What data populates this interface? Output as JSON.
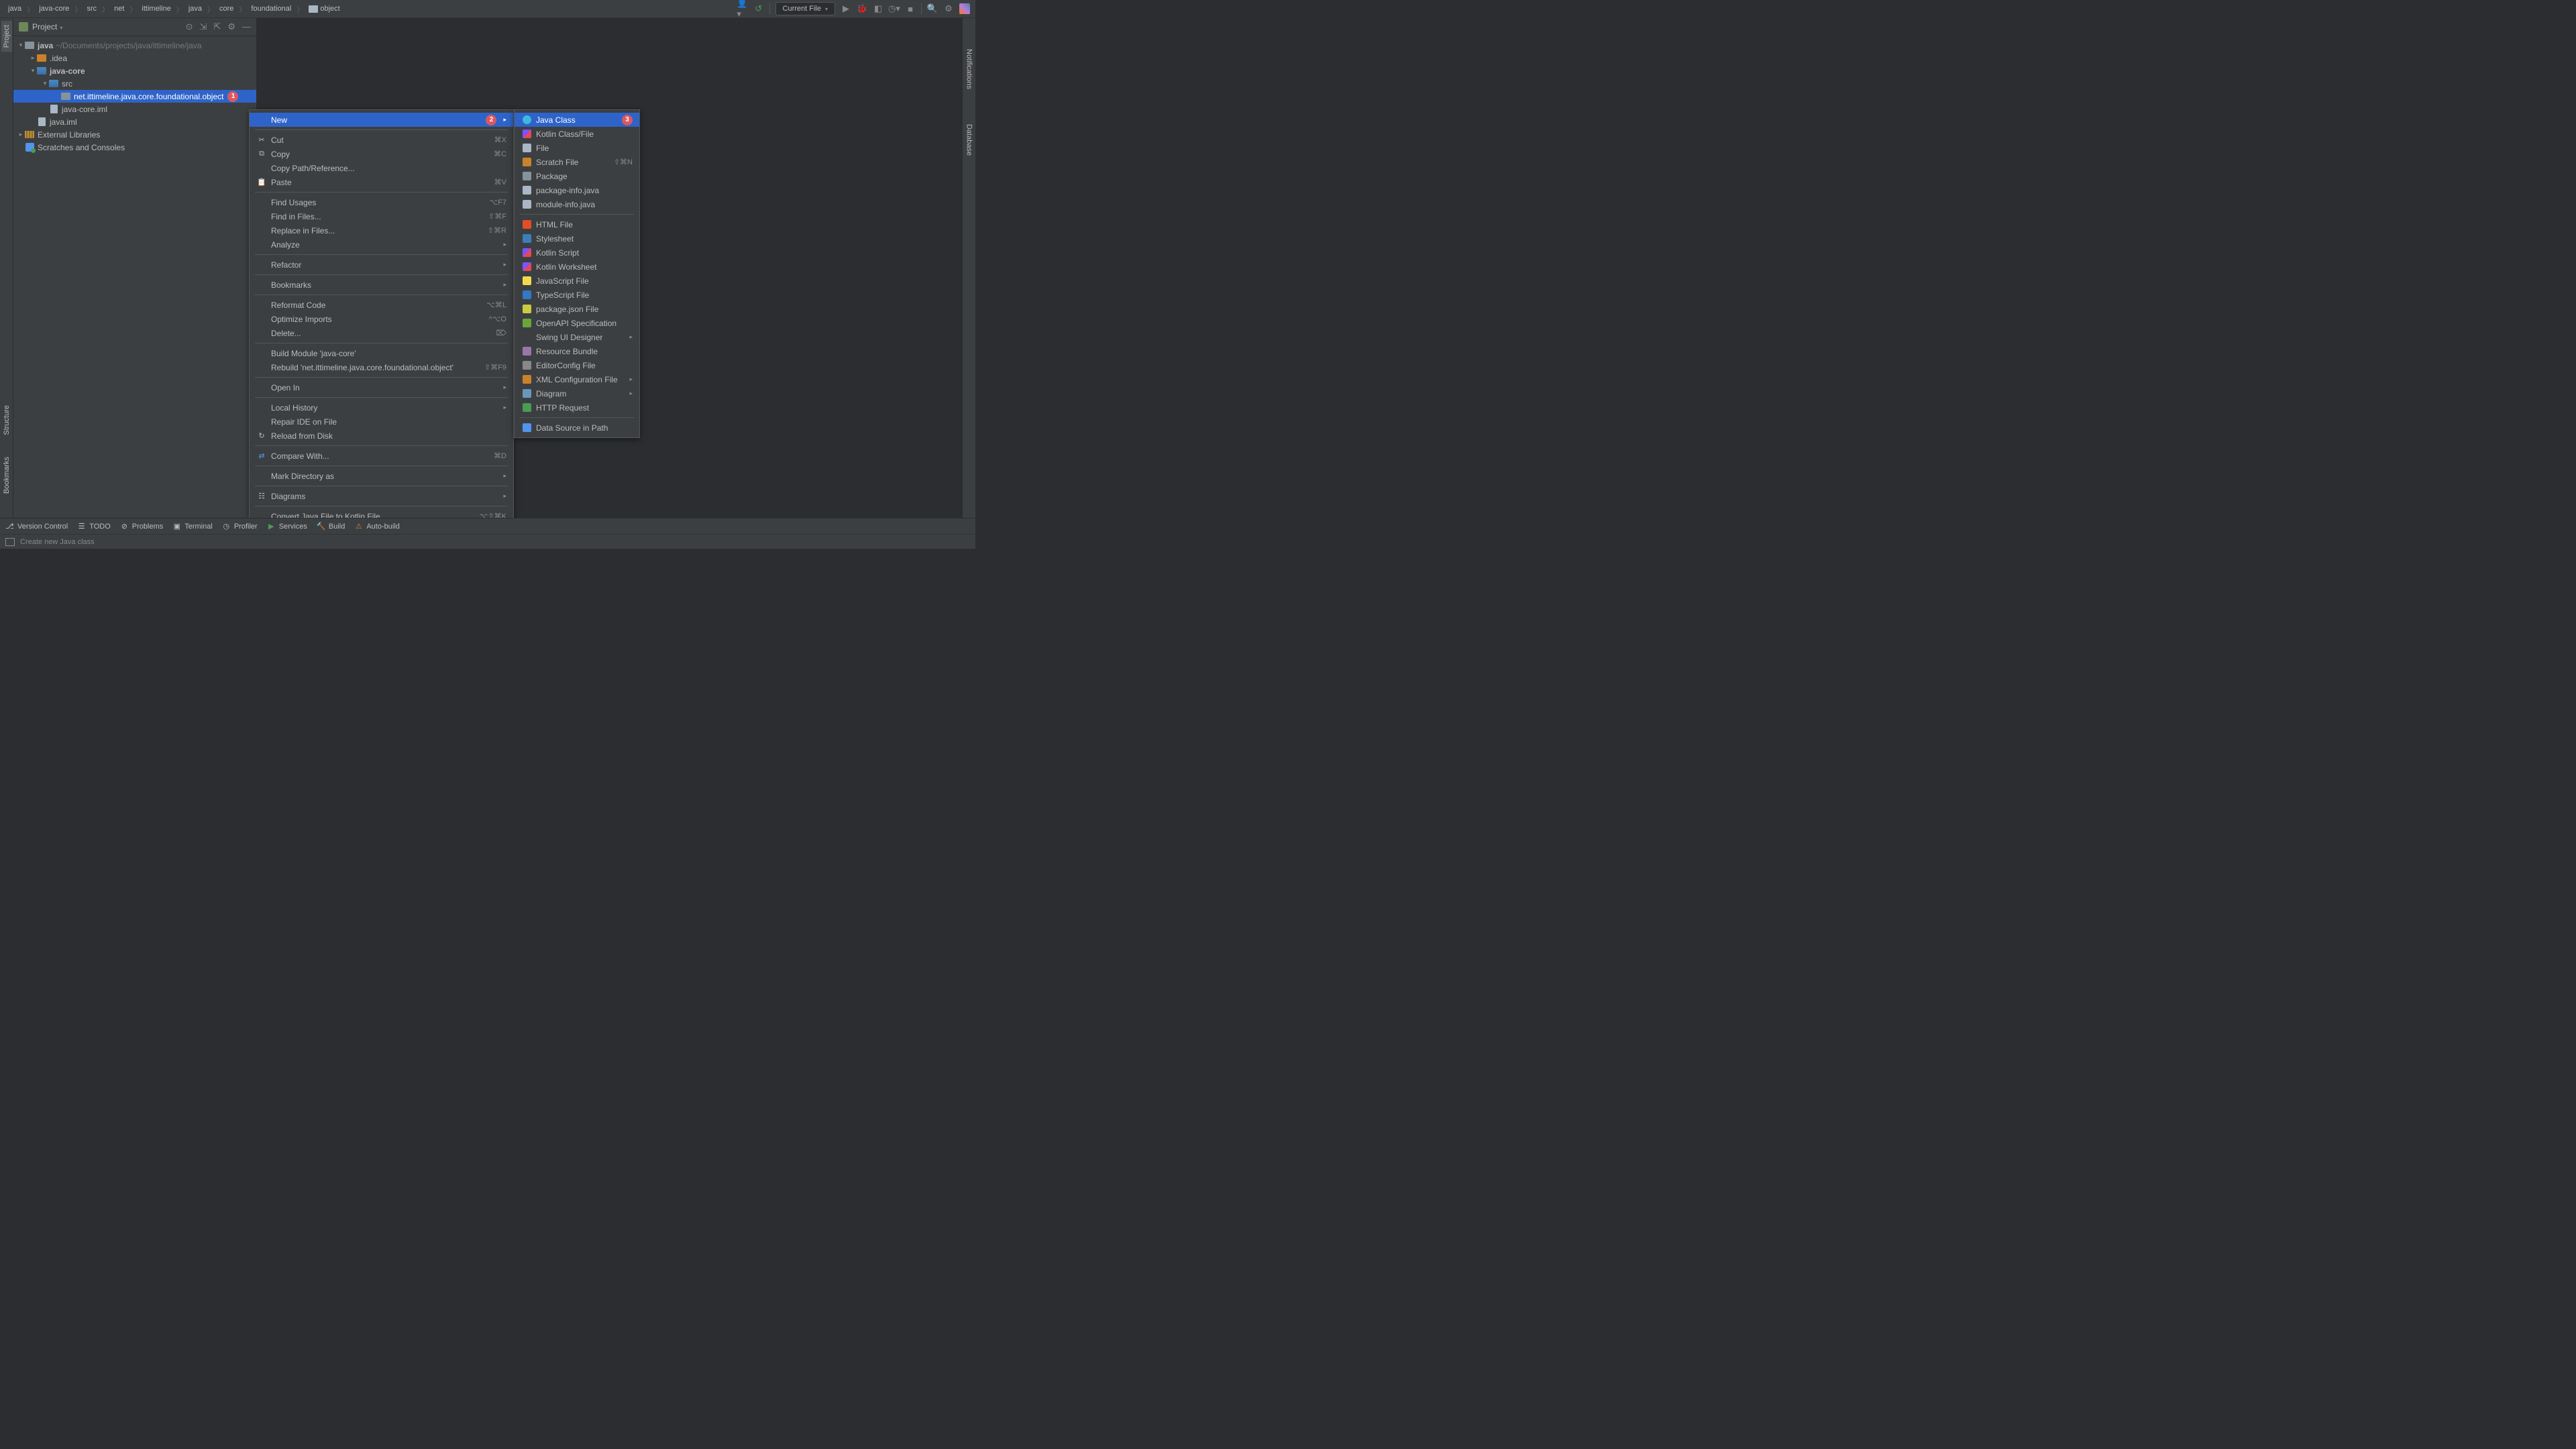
{
  "breadcrumbs": [
    "java",
    "java-core",
    "src",
    "net",
    "ittimeline",
    "java",
    "core",
    "foundational",
    "object"
  ],
  "topbar": {
    "run_config": "Current File"
  },
  "project": {
    "header": "Project",
    "tree": {
      "root_name": "java",
      "root_path": "~/Documents/projects/java/ittimeline/java",
      "idea": ".idea",
      "javacore": "java-core",
      "src": "src",
      "package": "net.ittimeline.java.core.foundational.object",
      "javacore_iml": "java-core.iml",
      "java_iml": "java.iml",
      "ext_libs": "External Libraries",
      "scratches": "Scratches and Consoles"
    }
  },
  "callouts": {
    "one": "1",
    "two": "2",
    "three": "3"
  },
  "context_menu": {
    "new": "New",
    "cut": {
      "label": "Cut",
      "sc": "⌘X"
    },
    "copy": {
      "label": "Copy",
      "sc": "⌘C"
    },
    "copy_path": "Copy Path/Reference...",
    "paste": {
      "label": "Paste",
      "sc": "⌘V"
    },
    "find_usages": {
      "label": "Find Usages",
      "sc": "⌥F7"
    },
    "find_in_files": {
      "label": "Find in Files...",
      "sc": "⇧⌘F"
    },
    "replace_in_files": {
      "label": "Replace in Files...",
      "sc": "⇧⌘R"
    },
    "analyze": "Analyze",
    "refactor": "Refactor",
    "bookmarks": "Bookmarks",
    "reformat": {
      "label": "Reformat Code",
      "sc": "⌥⌘L"
    },
    "optimize": {
      "label": "Optimize Imports",
      "sc": "^⌥O"
    },
    "delete": {
      "label": "Delete...",
      "sc": "⌦"
    },
    "build_module": "Build Module 'java-core'",
    "rebuild": {
      "label": "Rebuild 'net.ittimeline.java.core.foundational.object'",
      "sc": "⇧⌘F9"
    },
    "open_in": "Open In",
    "local_history": "Local History",
    "repair_ide": "Repair IDE on File",
    "reload": "Reload from Disk",
    "compare": {
      "label": "Compare With...",
      "sc": "⌘D"
    },
    "mark_dir": "Mark Directory as",
    "diagrams": "Diagrams",
    "convert_kotlin": {
      "label": "Convert Java File to Kotlin File",
      "sc": "⌥⇧⌘K"
    }
  },
  "new_submenu": {
    "java_class": "Java Class",
    "kotlin_class": "Kotlin Class/File",
    "file": "File",
    "scratch": {
      "label": "Scratch File",
      "sc": "⇧⌘N"
    },
    "package": "Package",
    "package_info": "package-info.java",
    "module_info": "module-info.java",
    "html": "HTML File",
    "stylesheet": "Stylesheet",
    "kotlin_script": "Kotlin Script",
    "kotlin_ws": "Kotlin Worksheet",
    "js": "JavaScript File",
    "ts": "TypeScript File",
    "packagejson": "package.json File",
    "openapi": "OpenAPI Specification",
    "swing": "Swing UI Designer",
    "resource": "Resource Bundle",
    "editorconfig": "EditorConfig File",
    "xml_config": "XML Configuration File",
    "diagram": "Diagram",
    "http": "HTTP Request",
    "datasource": "Data Source in Path"
  },
  "bottom": {
    "version_control": "Version Control",
    "todo": "TODO",
    "problems": "Problems",
    "terminal": "Terminal",
    "profiler": "Profiler",
    "services": "Services",
    "build": "Build",
    "autobuild": "Auto-build"
  },
  "status": {
    "message": "Create new Java class"
  },
  "sidebars": {
    "project": "Project",
    "structure": "Structure",
    "bookmarks": "Bookmarks",
    "notifications": "Notifications",
    "database": "Database"
  }
}
